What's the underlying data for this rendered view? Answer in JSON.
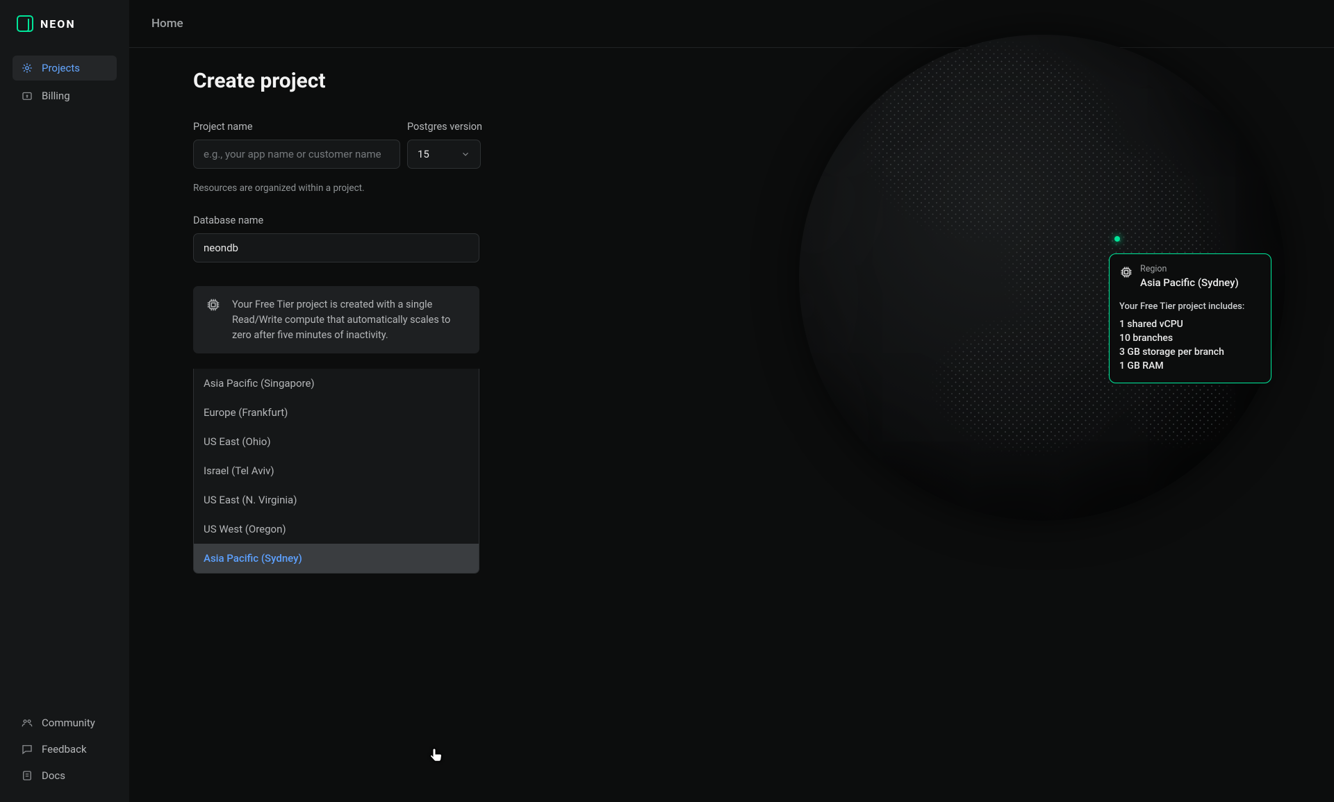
{
  "brand": "NEON",
  "nav": {
    "projects": "Projects",
    "billing": "Billing",
    "community": "Community",
    "feedback": "Feedback",
    "docs": "Docs"
  },
  "breadcrumb": "Home",
  "page_title": "Create project",
  "form": {
    "project_name_label": "Project name",
    "project_name_placeholder": "e.g., your app name or customer name",
    "project_name_help": "Resources are organized within a project.",
    "pg_version_label": "Postgres version",
    "pg_version_value": "15",
    "db_name_label": "Database name",
    "db_name_value": "neondb",
    "info_text": "Your Free Tier project is created with a single Read/Write compute that automatically scales to zero after five minutes of inactivity.",
    "region_label": "Region",
    "region_value": "Asia Pacific (Sydney)",
    "region_options": [
      "Asia Pacific (Singapore)",
      "Europe (Frankfurt)",
      "US East (Ohio)",
      "Israel (Tel Aviv)",
      "US East (N. Virginia)",
      "US West (Oregon)",
      "Asia Pacific (Sydney)"
    ]
  },
  "globe_card": {
    "label": "Region",
    "region_name": "Asia Pacific (Sydney)",
    "subtitle": "Your Free Tier project includes:",
    "specs": [
      "1 shared vCPU",
      "10 branches",
      "3 GB storage per branch",
      "1 GB RAM"
    ]
  }
}
